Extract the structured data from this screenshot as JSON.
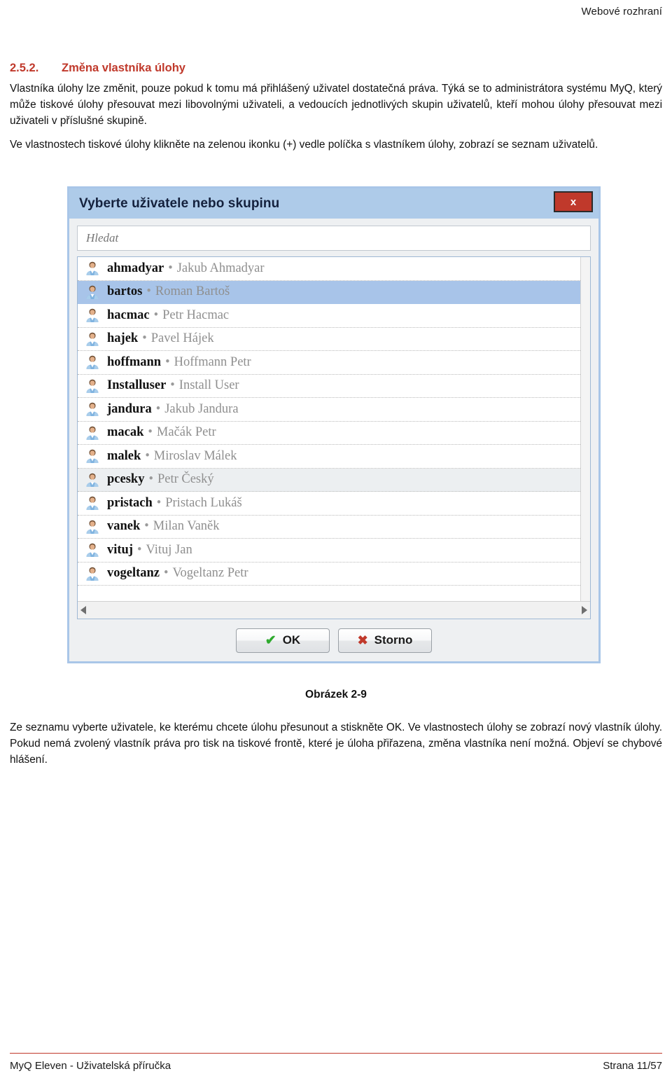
{
  "header": {
    "right_text": "Webové rozhraní"
  },
  "section": {
    "number": "2.5.2.",
    "title": "Změna vlastníka úlohy",
    "paragraph_1": "Vlastníka úlohy lze změnit, pouze pokud k tomu má přihlášený uživatel dostatečná práva. Týká se to administrátora systému MyQ, který může tiskové úlohy přesouvat mezi libovolnými uživateli, a vedoucích jednotlivých skupin uživatelů, kteří mohou úlohy přesouvat mezi uživateli v příslušné skupině.",
    "paragraph_2": "Ve vlastnostech tiskové úlohy klikněte na zelenou ikonku (+) vedle políčka s vlastníkem úlohy, zobrazí se seznam uživatelů.",
    "caption": "Obrázek 2-9",
    "paragraph_3": "Ze seznamu vyberte uživatele, ke kterému chcete úlohu přesunout a stiskněte OK. Ve vlastnostech úlohy se zobrazí nový vlastník úlohy. Pokud nemá zvolený vlastník práva pro tisk na tiskové frontě, které je úloha přiřazena, změna vlastníka není možná. Objeví se chybové hlášení."
  },
  "dialog": {
    "title": "Vyberte uživatele nebo skupinu",
    "close_label": "x",
    "search": {
      "placeholder": "Hledat",
      "value": ""
    },
    "separator": "•",
    "users": [
      {
        "username": "ahmadyar",
        "fullname": "Jakub Ahmadyar",
        "state": "normal"
      },
      {
        "username": "bartos",
        "fullname": "Roman Bartoš",
        "state": "selected"
      },
      {
        "username": "hacmac",
        "fullname": "Petr Hacmac",
        "state": "normal"
      },
      {
        "username": "hajek",
        "fullname": "Pavel Hájek",
        "state": "normal"
      },
      {
        "username": "hoffmann",
        "fullname": "Hoffmann Petr",
        "state": "normal"
      },
      {
        "username": "Installuser",
        "fullname": "Install User",
        "state": "normal"
      },
      {
        "username": "jandura",
        "fullname": "Jakub Jandura",
        "state": "normal"
      },
      {
        "username": "macak",
        "fullname": "Mačák Petr",
        "state": "normal"
      },
      {
        "username": "malek",
        "fullname": "Miroslav Málek",
        "state": "normal"
      },
      {
        "username": "pcesky",
        "fullname": "Petr Český",
        "state": "hover"
      },
      {
        "username": "pristach",
        "fullname": "Pristach Lukáš",
        "state": "normal"
      },
      {
        "username": "vanek",
        "fullname": "Milan Vaněk",
        "state": "normal"
      },
      {
        "username": "vituj",
        "fullname": "Vituj Jan",
        "state": "normal"
      },
      {
        "username": "vogeltanz",
        "fullname": "Vogeltanz Petr",
        "state": "normal"
      }
    ],
    "buttons": {
      "ok": "OK",
      "cancel": "Storno",
      "ok_glyph": "✔",
      "cancel_glyph": "✖"
    },
    "scrollbar": {
      "left_arrow": "◀",
      "right_arrow": "▶"
    }
  },
  "footer": {
    "left_text": "MyQ Eleven - Uživatelská příručka",
    "right_text": "Strana 11/57"
  },
  "colors": {
    "heading": "#c0392b",
    "dialog_titlebar": "#aecbe9",
    "close_button": "#c0392b",
    "row_selected": "#a8c4e9",
    "row_hover": "#eceff1",
    "footer_rule": "#c0392b"
  }
}
